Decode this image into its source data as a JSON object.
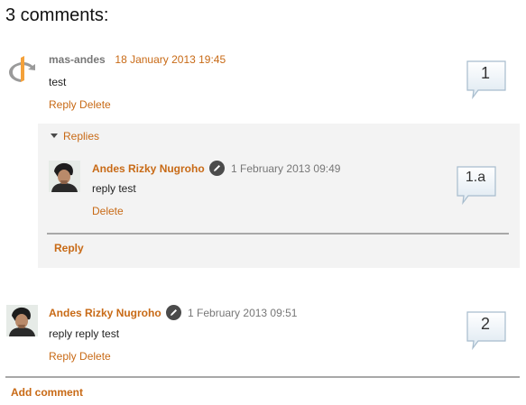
{
  "heading": "3 comments:",
  "comments": [
    {
      "author": "mas-andes",
      "date": "18 January 2013 19:45",
      "text": "test",
      "actions": {
        "reply": "Reply",
        "delete": "Delete"
      },
      "number": "1",
      "avatar": "openid-icon"
    },
    {
      "author": "Andes Rizky Nugroho",
      "date": "1 February 2013 09:51",
      "text": "reply reply test",
      "actions": {
        "reply": "Reply",
        "delete": "Delete"
      },
      "number": "2",
      "avatar": "user-photo"
    }
  ],
  "replies": {
    "toggle_label": "Replies",
    "items": [
      {
        "author": "Andes Rizky Nugroho",
        "date": "1 February 2013 09:49",
        "text": "reply test",
        "delete": "Delete",
        "number": "1.a",
        "avatar": "user-photo"
      }
    ],
    "reply_label": "Reply"
  },
  "add_comment": "Add comment",
  "colors": {
    "link": "#c86a16",
    "meta": "#777777",
    "replies_bg": "#f3f3f3",
    "divider": "#a8a8a8",
    "bubble_fill": "#eef4f9",
    "bubble_border": "#a7bccd"
  }
}
